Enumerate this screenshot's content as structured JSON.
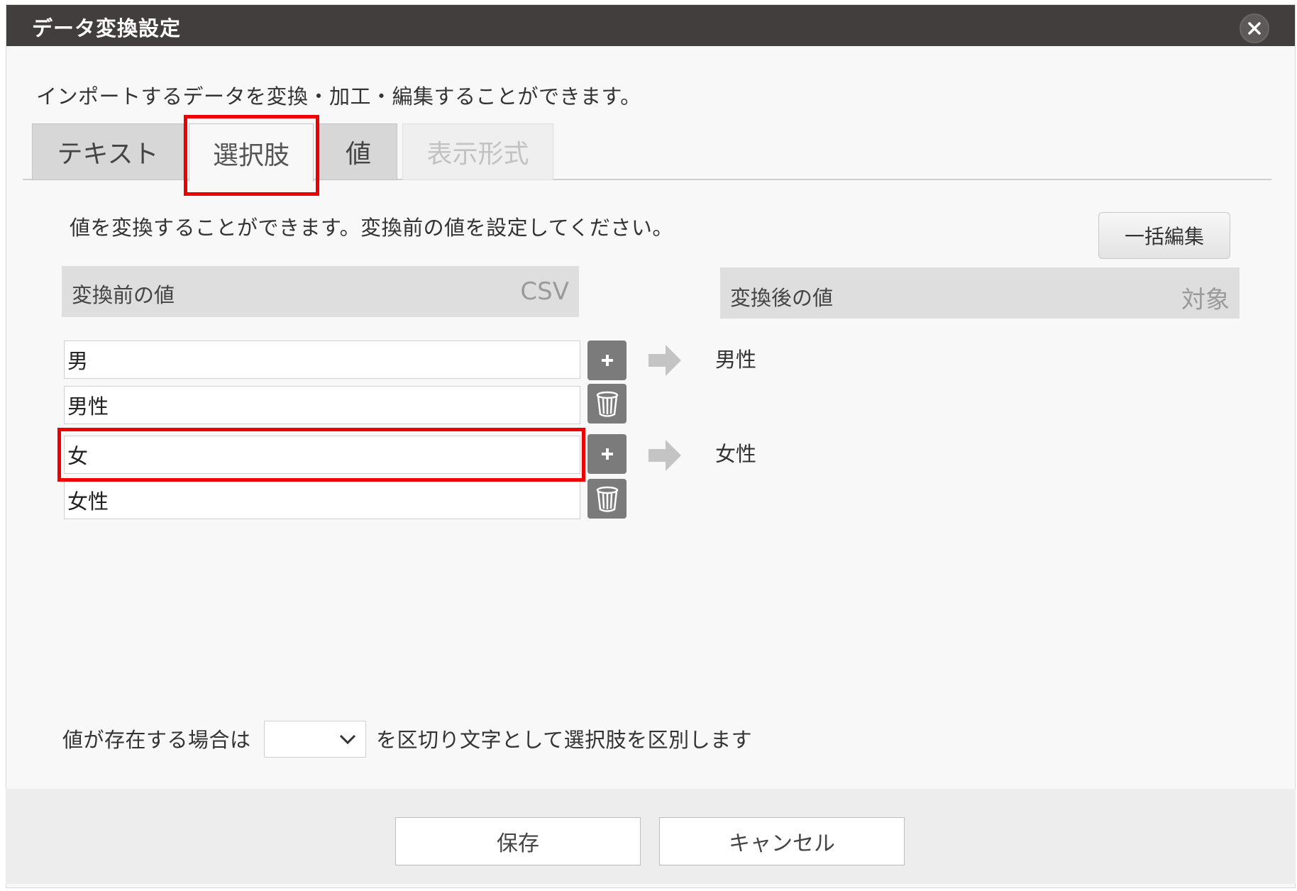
{
  "dialog": {
    "title": "データ変換設定",
    "intro": "インポートするデータを変換・加工・編集することができます。"
  },
  "tabs": [
    {
      "label": "テキスト",
      "state": "normal"
    },
    {
      "label": "選択肢",
      "state": "active"
    },
    {
      "label": "値",
      "state": "normal"
    },
    {
      "label": "表示形式",
      "state": "disabled"
    }
  ],
  "panel": {
    "description": "値を変換することができます。変換前の値を設定してください。",
    "bulk_edit_label": "一括編集",
    "before_header": {
      "label": "変換前の値",
      "tag": "CSV"
    },
    "after_header": {
      "label": "変換後の値",
      "tag": "対象"
    },
    "rows": [
      {
        "inputs": [
          "男",
          "男性"
        ],
        "result": "男性"
      },
      {
        "inputs": [
          "女",
          "女性"
        ],
        "result": "女性"
      }
    ]
  },
  "separator": {
    "prefix": "値が存在する場合は",
    "selected": "",
    "suffix": "を区切り文字として選択肢を区別します"
  },
  "footer": {
    "save_label": "保存",
    "cancel_label": "キャンセル"
  },
  "colors": {
    "titlebar": "#423e3d",
    "highlight": "#ee0000",
    "icon_button": "#7b7b7b"
  }
}
